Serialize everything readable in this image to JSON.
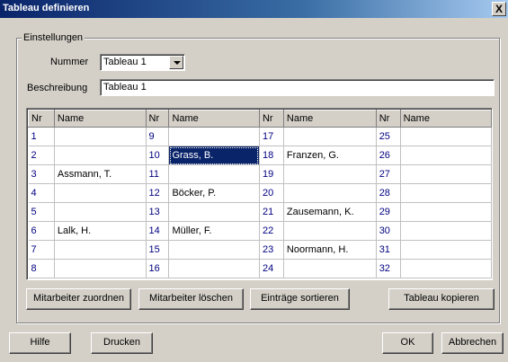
{
  "window": {
    "title": "Tableau definieren",
    "close_label": "X"
  },
  "group": {
    "legend": "Einstellungen",
    "nummer_label": "Nummer",
    "nummer_value": "Tableau 1",
    "beschreibung_label": "Beschreibung",
    "beschreibung_value": "Tableau 1"
  },
  "grid": {
    "headers": [
      "Nr",
      "Name",
      "Nr",
      "Name",
      "Nr",
      "Name",
      "Nr",
      "Name"
    ],
    "rows": [
      [
        {
          "nr": "1",
          "name": ""
        },
        {
          "nr": "9",
          "name": ""
        },
        {
          "nr": "17",
          "name": ""
        },
        {
          "nr": "25",
          "name": ""
        }
      ],
      [
        {
          "nr": "2",
          "name": ""
        },
        {
          "nr": "10",
          "name": "Grass, B."
        },
        {
          "nr": "18",
          "name": "Franzen, G."
        },
        {
          "nr": "26",
          "name": ""
        }
      ],
      [
        {
          "nr": "3",
          "name": "Assmann, T."
        },
        {
          "nr": "11",
          "name": ""
        },
        {
          "nr": "19",
          "name": ""
        },
        {
          "nr": "27",
          "name": ""
        }
      ],
      [
        {
          "nr": "4",
          "name": ""
        },
        {
          "nr": "12",
          "name": "Böcker, P."
        },
        {
          "nr": "20",
          "name": ""
        },
        {
          "nr": "28",
          "name": ""
        }
      ],
      [
        {
          "nr": "5",
          "name": ""
        },
        {
          "nr": "13",
          "name": ""
        },
        {
          "nr": "21",
          "name": "Zausemann, K."
        },
        {
          "nr": "29",
          "name": ""
        }
      ],
      [
        {
          "nr": "6",
          "name": "Lalk, H."
        },
        {
          "nr": "14",
          "name": "Müller, F."
        },
        {
          "nr": "22",
          "name": ""
        },
        {
          "nr": "30",
          "name": ""
        }
      ],
      [
        {
          "nr": "7",
          "name": ""
        },
        {
          "nr": "15",
          "name": ""
        },
        {
          "nr": "23",
          "name": "Noormann, H."
        },
        {
          "nr": "31",
          "name": ""
        }
      ],
      [
        {
          "nr": "8",
          "name": ""
        },
        {
          "nr": "16",
          "name": ""
        },
        {
          "nr": "24",
          "name": ""
        },
        {
          "nr": "32",
          "name": ""
        }
      ]
    ],
    "selected_cell": "Grass, B."
  },
  "actions": {
    "assign": "Mitarbeiter zuordnen",
    "delete": "Mitarbeiter löschen",
    "sort": "Einträge sortieren",
    "copy": "Tableau kopieren"
  },
  "footer": {
    "help": "Hilfe",
    "print": "Drucken",
    "ok": "OK",
    "cancel": "Abbrechen"
  }
}
